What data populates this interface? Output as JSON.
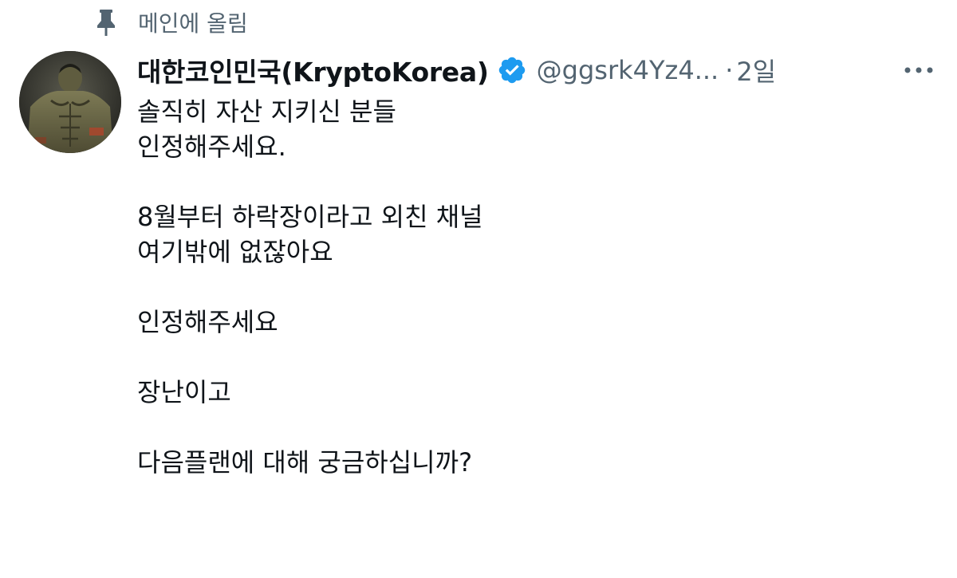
{
  "pinned": {
    "label": "메인에 올림",
    "icon": "pin-icon"
  },
  "author": {
    "display_name": "대한코인민국(KryptoKorea)",
    "handle": "@ggsrk4Yz4...",
    "verified_icon": "verified-badge-icon",
    "verified_color": "#1d9bf0",
    "avatar": "avatar-image"
  },
  "meta": {
    "separator": "·",
    "time": "2일",
    "more_icon": "more-horizontal-icon"
  },
  "tweet": {
    "lines": [
      "솔직히 자산 지키신 분들",
      "인정해주세요.",
      "",
      "8월부터 하락장이라고 외친 채널",
      "여기밖에 없잖아요",
      "",
      "인정해주세요",
      "",
      "장난이고",
      "",
      "다음플랜에 대해 궁금하십니까?"
    ]
  },
  "colors": {
    "text_primary": "#0f1419",
    "text_secondary": "#536471",
    "background": "#ffffff"
  }
}
